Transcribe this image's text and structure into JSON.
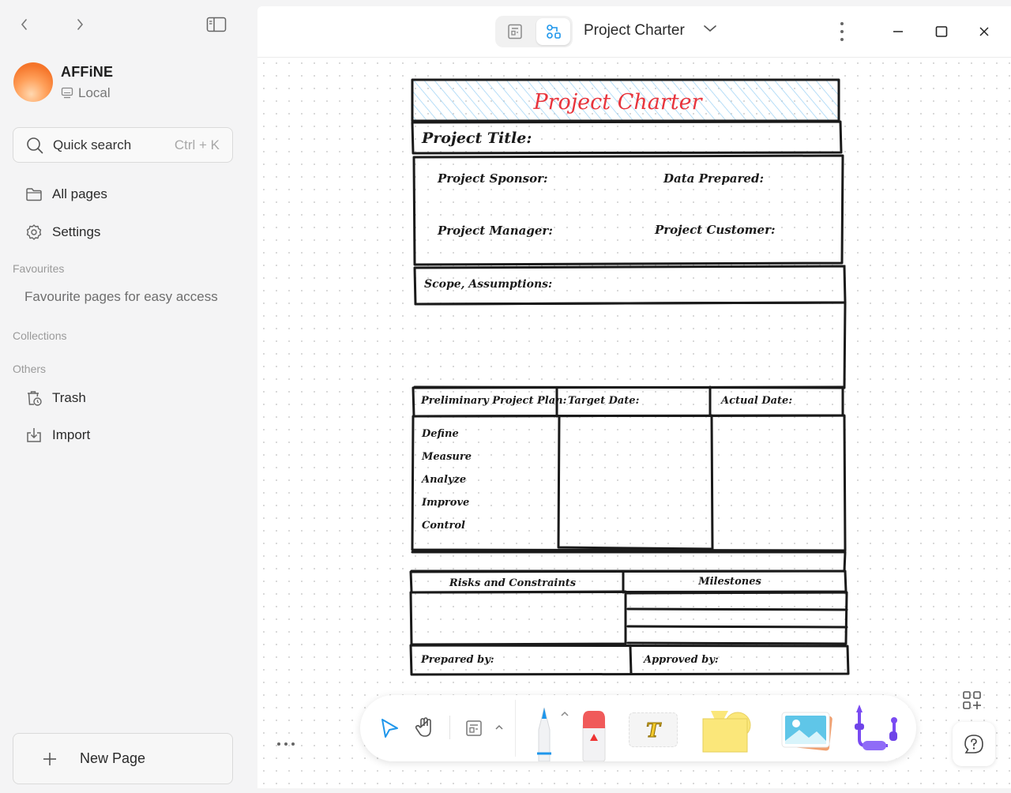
{
  "workspace": {
    "name": "AFFiNE",
    "type": "Local"
  },
  "search": {
    "label": "Quick search",
    "shortcut": "Ctrl + K"
  },
  "menu": {
    "all_pages": "All pages",
    "settings": "Settings",
    "trash": "Trash",
    "import": "Import"
  },
  "sections": {
    "favourites": "Favourites",
    "favourites_empty": "Favourite pages for easy access",
    "collections": "Collections",
    "others": "Others"
  },
  "new_page": "New Page",
  "header": {
    "title": "Project Charter"
  },
  "charter": {
    "heading": "Project Charter",
    "project_title": "Project Title:",
    "sponsor": "Project Sponsor:",
    "date_prepared": "Data Prepared:",
    "manager": "Project Manager:",
    "customer": "Project Customer:",
    "scope": "Scope, Assumptions:",
    "prelim_plan": "Preliminary Project Plan:",
    "target_date": "Target Date:",
    "actual_date": "Actual Date:",
    "phases": [
      "Define",
      "Measure",
      "Analyze",
      "Improve",
      "Control"
    ],
    "risks": "Risks and Constraints",
    "milestones": "Milestones",
    "prepared_by": "Prepared by:",
    "approved_by": "Approved by:"
  },
  "toolbar": {
    "text_tool_glyph": "T"
  },
  "colors": {
    "accent": "#1e96eb",
    "heading_red": "#e8343c",
    "note_yellow": "#fbe77a",
    "hatch_blue": "#9fd3f5"
  }
}
